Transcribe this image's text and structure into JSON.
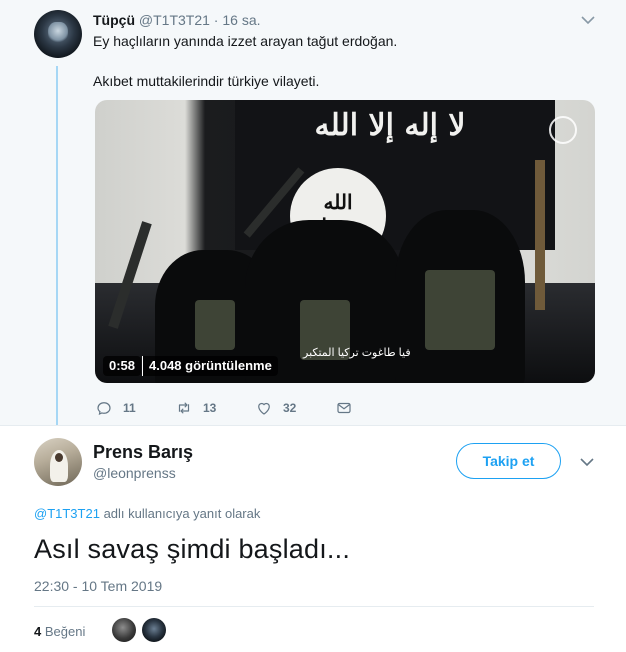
{
  "parent_tweet": {
    "name": "Tüpçü",
    "handle": "@T1T3T21",
    "time": "16 sa.",
    "text_line1": "Ey haçlıların yanında izzet arayan tağut erdoğan.",
    "text_line2": "Akıbet muttakilerindir türkiye vilayeti.",
    "media": {
      "video_caption": "فيا طاغوت تركيا المتكبر",
      "duration": "0:58",
      "views": "4.048 görüntülenme"
    },
    "actions": {
      "replies": "11",
      "retweets": "13",
      "likes": "32"
    }
  },
  "main_tweet": {
    "name": "Prens Barış",
    "handle": "@leonprenss",
    "follow_label": "Takip et",
    "reply_mention": "@T1T3T21",
    "reply_suffix": " adlı kullanıcıya yanıt olarak",
    "text": "Asıl savaş şimdi başladı...",
    "timestamp": "22:30 - 10 Tem 2019",
    "likes_count": "4",
    "likes_label": "Beğeni"
  },
  "colors": {
    "accent": "#1da1f2",
    "muted": "#657786",
    "thread_line": "#a6d7f5",
    "parent_bg": "#f5f8fa"
  },
  "icons": [
    "chevron-down-icon",
    "reply-icon",
    "retweet-icon",
    "heart-icon",
    "message-icon"
  ]
}
